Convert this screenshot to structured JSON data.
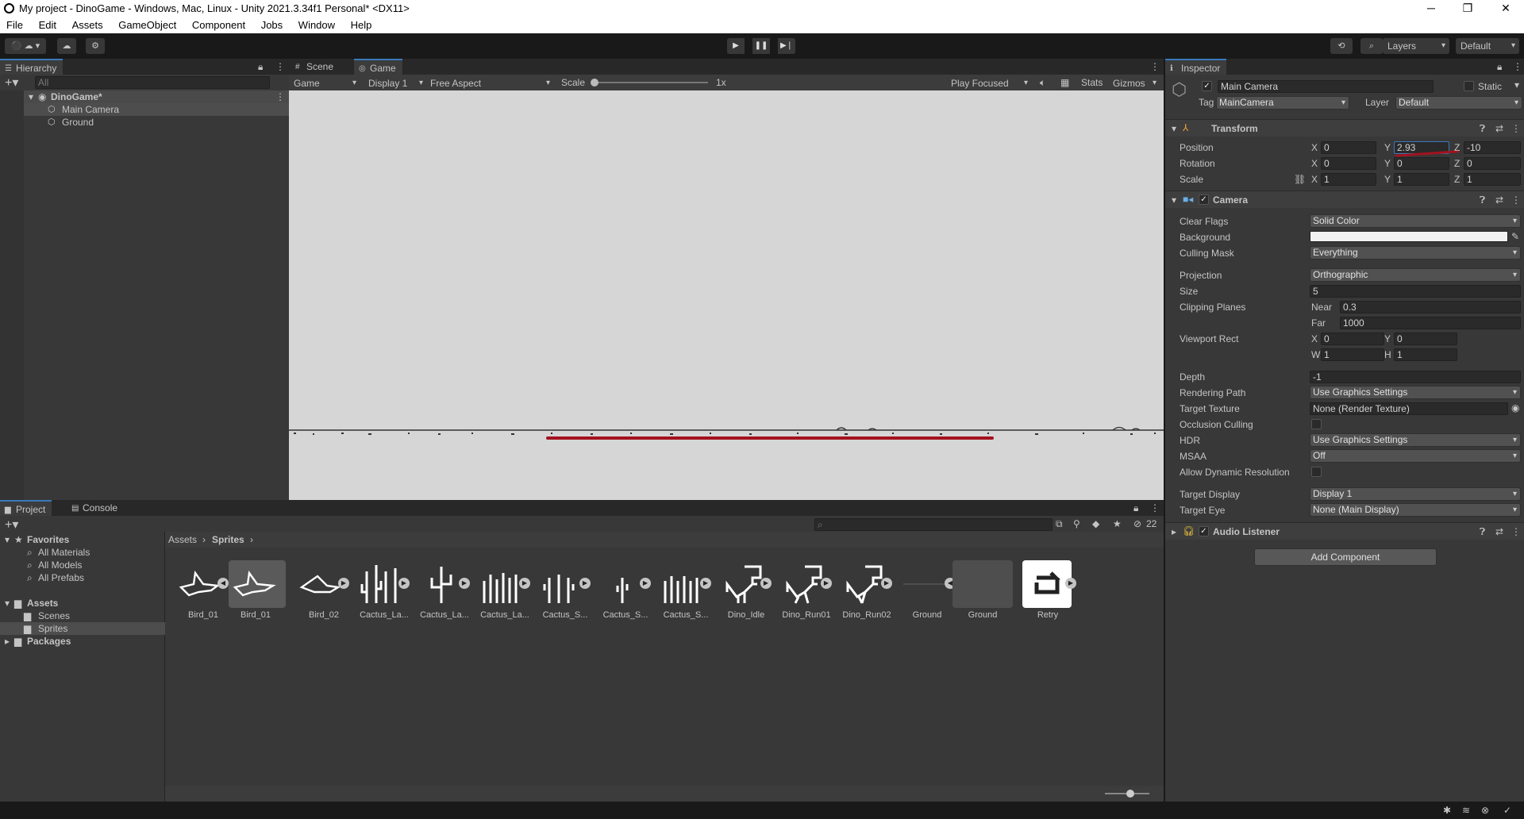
{
  "window": {
    "title": "My project - DinoGame - Windows, Mac, Linux - Unity 2021.3.34f1 Personal* <DX11>",
    "minimize": "─",
    "maximize": "❐",
    "close": "✕"
  },
  "menu": [
    "File",
    "Edit",
    "Assets",
    "GameObject",
    "Component",
    "Jobs",
    "Window",
    "Help"
  ],
  "toolbar": {
    "layers": "Layers",
    "layout": "Default"
  },
  "hierarchy": {
    "tab": "Hierarchy",
    "search_placeholder": "All",
    "scene": "DinoGame*",
    "items": [
      "Main Camera",
      "Ground"
    ]
  },
  "scene_view": {
    "tabs": [
      "Scene",
      "Game"
    ],
    "game_mode": "Game",
    "display": "Display 1",
    "aspect": "Free Aspect",
    "scale_label": "Scale",
    "scale_value": "1x",
    "play_mode": "Play Focused",
    "stats": "Stats",
    "gizmos": "Gizmos",
    "background_color": "#d6d6d6"
  },
  "project": {
    "tabs": [
      "Project",
      "Console"
    ],
    "favorites_label": "Favorites",
    "favorites": [
      "All Materials",
      "All Models",
      "All Prefabs"
    ],
    "assets_label": "Assets",
    "assets_children": [
      "Scenes",
      "Sprites"
    ],
    "packages_label": "Packages",
    "breadcrumb": [
      "Assets",
      "Sprites"
    ],
    "hidden_count": "22",
    "items": [
      {
        "label": "Bird_01",
        "icon": "bird-icon",
        "play": true
      },
      {
        "label": "Bird_01",
        "icon": "bird-icon",
        "play": false
      },
      {
        "label": "Bird_02",
        "icon": "bird-icon",
        "play": true
      },
      {
        "label": "Cactus_La...",
        "icon": "cactus-icon",
        "play": true
      },
      {
        "label": "Cactus_La...",
        "icon": "cactus-icon",
        "play": true
      },
      {
        "label": "Cactus_La...",
        "icon": "cactus-icon",
        "play": true
      },
      {
        "label": "Cactus_S...",
        "icon": "cactus-icon",
        "play": true
      },
      {
        "label": "Cactus_S...",
        "icon": "cactus-icon",
        "play": true
      },
      {
        "label": "Cactus_S...",
        "icon": "cactus-icon",
        "play": true
      },
      {
        "label": "Dino_Idle",
        "icon": "dino-icon",
        "play": true
      },
      {
        "label": "Dino_Run01",
        "icon": "dino-icon",
        "play": true
      },
      {
        "label": "Dino_Run02",
        "icon": "dino-icon",
        "play": true
      },
      {
        "label": "Ground",
        "icon": "ground-icon",
        "play": false
      },
      {
        "label": "Ground",
        "icon": "prefab-icon",
        "play": false
      },
      {
        "label": "Retry",
        "icon": "retry-icon",
        "play": true
      }
    ]
  },
  "inspector": {
    "tab": "Inspector",
    "object_name": "Main Camera",
    "static_label": "Static",
    "tag_label": "Tag",
    "tag": "MainCamera",
    "layer_label": "Layer",
    "layer": "Default",
    "transform": {
      "title": "Transform",
      "position_label": "Position",
      "position": {
        "x": "0",
        "y": "2.93",
        "z": "-10"
      },
      "rotation_label": "Rotation",
      "rotation": {
        "x": "0",
        "y": "0",
        "z": "0"
      },
      "scale_label": "Scale",
      "scale": {
        "x": "1",
        "y": "1",
        "z": "1"
      }
    },
    "camera": {
      "title": "Camera",
      "clear_flags_label": "Clear Flags",
      "clear_flags": "Solid Color",
      "background_label": "Background",
      "culling_mask_label": "Culling Mask",
      "culling_mask": "Everything",
      "projection_label": "Projection",
      "projection": "Orthographic",
      "size_label": "Size",
      "size": "5",
      "clipping_label": "Clipping Planes",
      "near_label": "Near",
      "near": "0.3",
      "far_label": "Far",
      "far": "1000",
      "viewport_label": "Viewport Rect",
      "vx": "0",
      "vy": "0",
      "vw": "1",
      "vh": "1",
      "depth_label": "Depth",
      "depth": "-1",
      "rendering_path_label": "Rendering Path",
      "rendering_path": "Use Graphics Settings",
      "target_texture_label": "Target Texture",
      "target_texture": "None (Render Texture)",
      "occlusion_label": "Occlusion Culling",
      "hdr_label": "HDR",
      "hdr": "Use Graphics Settings",
      "msaa_label": "MSAA",
      "msaa": "Off",
      "dynres_label": "Allow Dynamic Resolution",
      "target_display_label": "Target Display",
      "target_display": "Display 1",
      "target_eye_label": "Target Eye",
      "target_eye": "None (Main Display)"
    },
    "audio_listener": "Audio Listener",
    "add_component": "Add Component",
    "axis": {
      "x": "X",
      "y": "Y",
      "z": "Z",
      "w": "W",
      "h": "H"
    }
  }
}
